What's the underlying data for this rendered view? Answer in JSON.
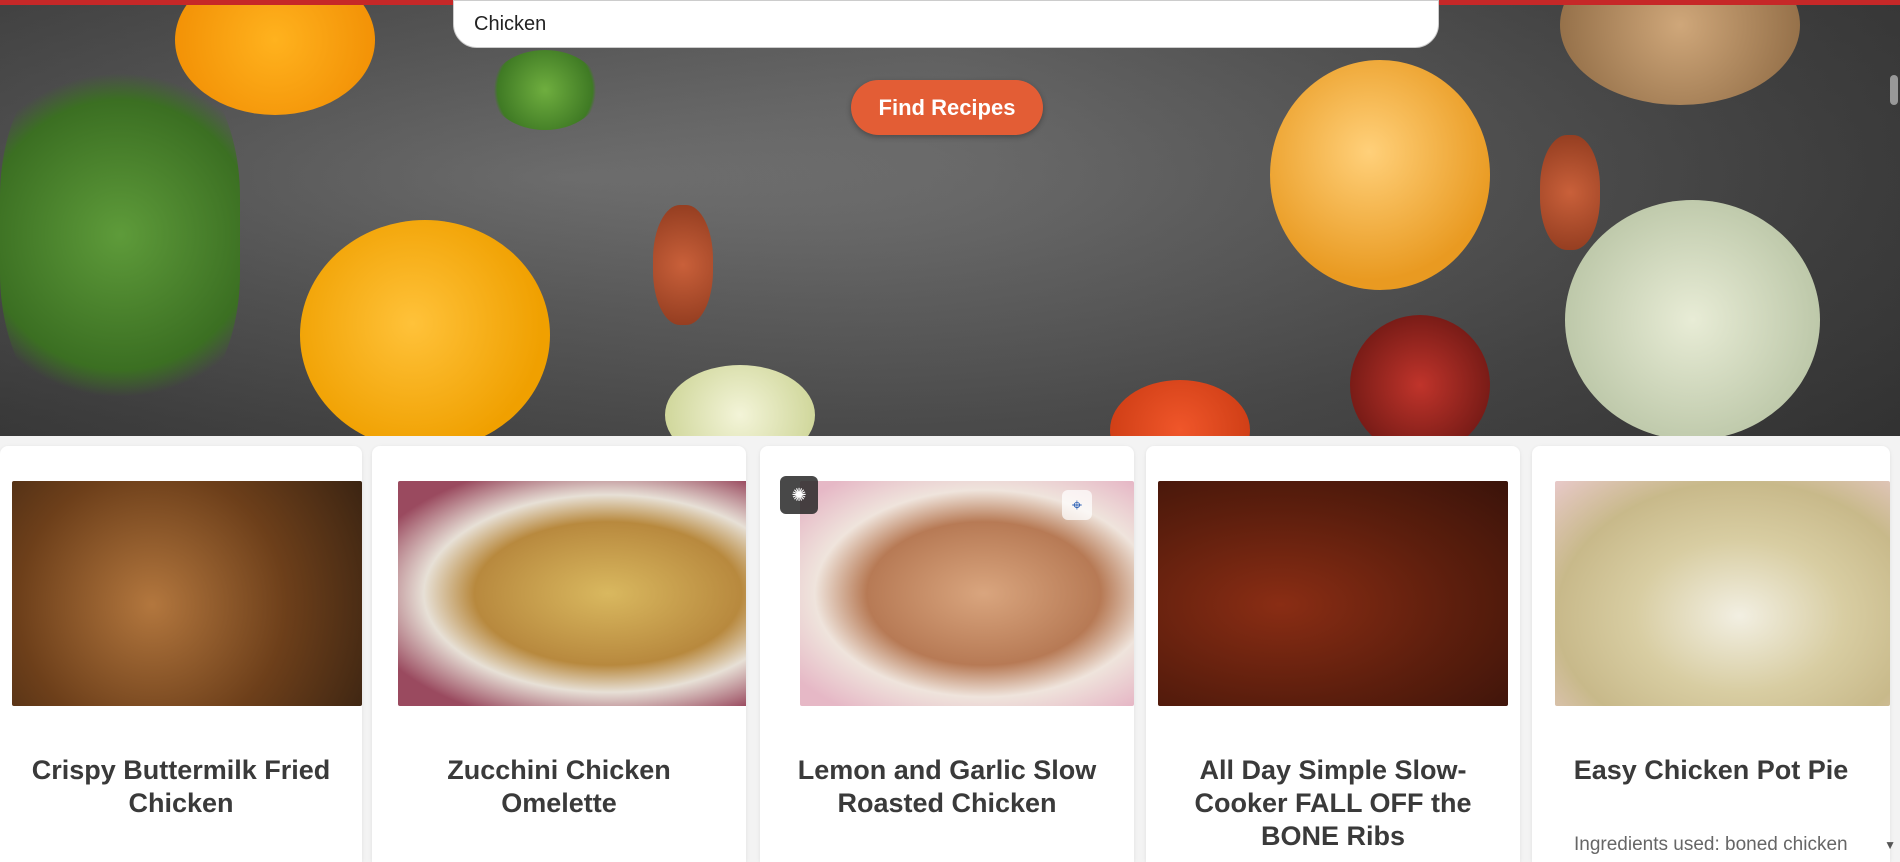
{
  "search": {
    "value": "Chicken"
  },
  "actions": {
    "find_label": "Find Recipes"
  },
  "colors": {
    "accent": "#e35d35",
    "top_strip": "#c62828",
    "title_text": "#3a3a3a"
  },
  "recipes": [
    {
      "title": "Crispy Buttermilk Fried Chicken",
      "image": "fried-chicken"
    },
    {
      "title": "Zucchini Chicken Omelette",
      "image": "omelette"
    },
    {
      "title": "Lemon and Garlic Slow Roasted Chicken",
      "image": "roast-chicken"
    },
    {
      "title": "All Day Simple Slow-Cooker FALL OFF the BONE Ribs",
      "image": "ribs"
    },
    {
      "title": "Easy Chicken Pot Pie",
      "image": "pot-pie",
      "ingredients": "Ingredients used: boned chicken"
    }
  ],
  "overlays": {
    "brain_icon": "brain-icon",
    "lens_icon": "lens-icon"
  }
}
